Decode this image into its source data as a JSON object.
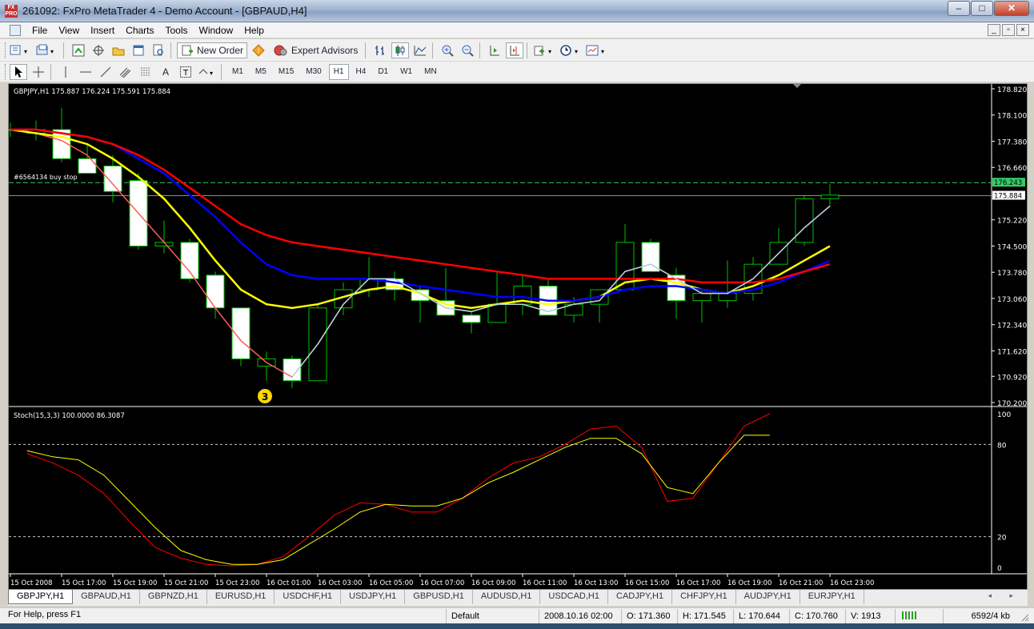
{
  "window": {
    "title": "261092: FxPro MetaTrader 4 - Demo Account - [GBPAUD,H4]",
    "app_icon_text": "FX PRO",
    "controls": [
      "–",
      "□",
      "✕"
    ]
  },
  "menu": {
    "items": [
      "File",
      "View",
      "Insert",
      "Charts",
      "Tools",
      "Window",
      "Help"
    ],
    "mdi_controls": [
      "_",
      "▫",
      "×"
    ]
  },
  "toolbar": {
    "new_order": "New Order",
    "expert_advisors": "Expert Advisors"
  },
  "drawing_toolbar": {
    "text_tool": "A",
    "label_tool": "T"
  },
  "timeframes": [
    "M1",
    "M5",
    "M15",
    "M30",
    "H1",
    "H4",
    "D1",
    "W1",
    "MN"
  ],
  "active_timeframe": "H1",
  "chart": {
    "header": "GBPJPY,H1  175.887 176.224 175.591 175.884",
    "order_label": "#6564134 buy stop",
    "order_price": "176.243",
    "bid_price": "175.884",
    "marker_label": "3",
    "colors": {
      "bull": "#00c000",
      "bear_body": "#ffffff",
      "ma_fast": "#ff5a5a",
      "ma_yellow": "#ffff00",
      "ma_blue": "#0000ff",
      "ma_red": "#ff0000",
      "ma_light": "#add8e6",
      "order_line": "#33cc66",
      "grid": "#ffffff"
    },
    "y_ticks": [
      "178.820",
      "178.100",
      "177.380",
      "176.660",
      "175.220",
      "174.500",
      "173.780",
      "173.060",
      "172.340",
      "171.620",
      "170.920",
      "170.200"
    ],
    "x_ticks": [
      "15 Oct 2008",
      "15 Oct 17:00",
      "15 Oct 19:00",
      "15 Oct 21:00",
      "15 Oct 23:00",
      "16 Oct 01:00",
      "16 Oct 03:00",
      "16 Oct 05:00",
      "16 Oct 07:00",
      "16 Oct 09:00",
      "16 Oct 11:00",
      "16 Oct 13:00",
      "16 Oct 15:00",
      "16 Oct 17:00",
      "16 Oct 19:00",
      "16 Oct 21:00",
      "16 Oct 23:00"
    ]
  },
  "stoch": {
    "header": "Stoch(15,3,3) 100.0000 86.3087",
    "y_ticks": [
      "100",
      "80",
      "20",
      "0"
    ]
  },
  "chart_data": [
    {
      "type": "candlestick",
      "title": "GBPJPY,H1",
      "ylim": [
        170.2,
        178.82
      ],
      "bars": [
        {
          "o": 177.7,
          "h": 177.9,
          "l": 177.5,
          "c": 177.7
        },
        {
          "o": 177.6,
          "h": 177.95,
          "l": 177.4,
          "c": 177.7
        },
        {
          "o": 177.7,
          "h": 178.3,
          "l": 176.8,
          "c": 176.9
        },
        {
          "o": 176.9,
          "h": 177.3,
          "l": 176.5,
          "c": 176.5
        },
        {
          "o": 176.7,
          "h": 177.0,
          "l": 175.7,
          "c": 176.0
        },
        {
          "o": 176.3,
          "h": 176.5,
          "l": 174.4,
          "c": 174.5
        },
        {
          "o": 174.5,
          "h": 175.2,
          "l": 174.3,
          "c": 174.6
        },
        {
          "o": 174.6,
          "h": 174.7,
          "l": 173.5,
          "c": 173.6
        },
        {
          "o": 173.7,
          "h": 173.8,
          "l": 172.5,
          "c": 172.8
        },
        {
          "o": 172.8,
          "h": 172.8,
          "l": 171.2,
          "c": 171.4
        },
        {
          "o": 171.2,
          "h": 171.6,
          "l": 170.8,
          "c": 171.4
        },
        {
          "o": 171.4,
          "h": 171.5,
          "l": 170.6,
          "c": 170.8
        },
        {
          "o": 170.8,
          "h": 172.9,
          "l": 170.8,
          "c": 172.8
        },
        {
          "o": 172.8,
          "h": 173.5,
          "l": 172.6,
          "c": 173.3
        },
        {
          "o": 173.3,
          "h": 174.2,
          "l": 173.1,
          "c": 173.6
        },
        {
          "o": 173.6,
          "h": 173.8,
          "l": 173.0,
          "c": 173.3
        },
        {
          "o": 173.3,
          "h": 173.4,
          "l": 172.4,
          "c": 173.0
        },
        {
          "o": 173.0,
          "h": 173.9,
          "l": 172.6,
          "c": 172.6
        },
        {
          "o": 172.6,
          "h": 172.7,
          "l": 172.1,
          "c": 172.4
        },
        {
          "o": 172.4,
          "h": 173.8,
          "l": 172.4,
          "c": 172.9
        },
        {
          "o": 172.9,
          "h": 173.7,
          "l": 172.6,
          "c": 173.4
        },
        {
          "o": 173.4,
          "h": 173.6,
          "l": 172.6,
          "c": 172.6
        },
        {
          "o": 172.6,
          "h": 173.1,
          "l": 172.4,
          "c": 172.9
        },
        {
          "o": 172.9,
          "h": 173.3,
          "l": 172.4,
          "c": 173.3
        },
        {
          "o": 173.3,
          "h": 175.1,
          "l": 173.3,
          "c": 174.6
        },
        {
          "o": 174.6,
          "h": 174.7,
          "l": 173.8,
          "c": 173.8
        },
        {
          "o": 173.7,
          "h": 173.9,
          "l": 172.5,
          "c": 173.0
        },
        {
          "o": 173.0,
          "h": 173.3,
          "l": 172.4,
          "c": 173.2
        },
        {
          "o": 173.0,
          "h": 174.1,
          "l": 172.8,
          "c": 173.2
        },
        {
          "o": 173.2,
          "h": 174.2,
          "l": 173.0,
          "c": 174.0
        },
        {
          "o": 174.0,
          "h": 175.0,
          "l": 174.0,
          "c": 174.6
        },
        {
          "o": 174.6,
          "h": 175.9,
          "l": 174.5,
          "c": 175.8
        },
        {
          "o": 175.8,
          "h": 176.2,
          "l": 175.6,
          "c": 175.9
        }
      ],
      "series": [
        {
          "color": "#ff5a5a",
          "values": [
            177.7,
            177.6,
            177.4,
            177.0,
            176.2,
            175.4,
            174.6,
            173.8,
            172.8,
            171.9,
            171.3,
            170.9,
            171.8,
            172.9,
            173.6,
            173.6,
            173.2,
            172.8,
            172.7,
            172.9,
            172.9,
            172.7,
            172.9,
            173.0,
            173.8,
            174.0,
            173.6,
            173.2,
            173.2,
            173.6,
            174.3,
            175.0,
            175.6
          ]
        },
        {
          "color": "#ffff00",
          "values": [
            177.7,
            177.6,
            177.5,
            177.3,
            176.9,
            176.4,
            175.8,
            175.0,
            174.1,
            173.3,
            172.9,
            172.8,
            172.9,
            173.1,
            173.3,
            173.4,
            173.2,
            172.9,
            172.8,
            172.9,
            173.0,
            172.9,
            173.0,
            173.1,
            173.5,
            173.6,
            173.5,
            173.3,
            173.2,
            173.4,
            173.7,
            174.1,
            174.5
          ]
        },
        {
          "color": "#0000ff",
          "values": [
            177.7,
            177.7,
            177.6,
            177.5,
            177.3,
            176.9,
            176.5,
            175.9,
            175.3,
            174.6,
            174.0,
            173.7,
            173.6,
            173.6,
            173.6,
            173.5,
            173.4,
            173.3,
            173.2,
            173.1,
            173.1,
            173.0,
            173.0,
            173.1,
            173.3,
            173.4,
            173.4,
            173.3,
            173.2,
            173.3,
            173.5,
            173.8,
            174.1
          ]
        },
        {
          "color": "#ff0000",
          "values": [
            177.7,
            177.7,
            177.6,
            177.5,
            177.3,
            177.0,
            176.6,
            176.1,
            175.6,
            175.1,
            174.8,
            174.6,
            174.5,
            174.4,
            174.3,
            174.2,
            174.1,
            174.0,
            173.9,
            173.8,
            173.7,
            173.6,
            173.6,
            173.6,
            173.6,
            173.6,
            173.6,
            173.5,
            173.5,
            173.5,
            173.6,
            173.8,
            174.0
          ]
        },
        {
          "color": "#add8e6",
          "values": [
            null,
            null,
            null,
            null,
            null,
            null,
            null,
            null,
            null,
            null,
            null,
            170.9,
            171.8,
            172.9,
            173.6,
            173.6,
            173.2,
            172.8,
            172.7,
            172.9,
            172.9,
            172.7,
            172.9,
            173.0,
            173.8,
            174.0,
            173.6,
            173.2,
            173.2,
            173.6,
            174.3,
            175.0,
            175.6
          ]
        }
      ]
    },
    {
      "type": "line",
      "title": "Stoch(15,3,3)",
      "ylim": [
        0,
        100
      ],
      "levels": [
        20,
        80
      ],
      "series": [
        {
          "name": "%K",
          "color": "#ff0000",
          "values": [
            74,
            68,
            60,
            48,
            30,
            13,
            6,
            2,
            1,
            2,
            7,
            20,
            34,
            42,
            41,
            36,
            36,
            45,
            58,
            68,
            72,
            80,
            90,
            92,
            78,
            43,
            45,
            68,
            92,
            100
          ]
        },
        {
          "name": "%D",
          "color": "#ffff00",
          "values": [
            76,
            72,
            70,
            60,
            43,
            26,
            11,
            5,
            2,
            2,
            5,
            15,
            25,
            36,
            41,
            40,
            40,
            45,
            55,
            62,
            70,
            78,
            84,
            84,
            74,
            52,
            48,
            68,
            86,
            86
          ]
        }
      ]
    }
  ],
  "tabs": [
    "GBPJPY,H1",
    "GBPAUD,H1",
    "GBPNZD,H1",
    "EURUSD,H1",
    "USDCHF,H1",
    "USDJPY,H1",
    "GBPUSD,H1",
    "AUDUSD,H1",
    "USDCAD,H1",
    "CADJPY,H1",
    "CHFJPY,H1",
    "AUDJPY,H1",
    "EURJPY,H1"
  ],
  "tab_arrows": "◂ ▸",
  "status": {
    "help": "For Help, press F1",
    "profile": "Default",
    "datetime": "2008.10.16 02:00",
    "open": "O: 171.360",
    "high": "H: 171.545",
    "low": "L: 170.644",
    "close": "C: 170.760",
    "volume": "V: 1913",
    "traffic": "6592/4 kb"
  }
}
